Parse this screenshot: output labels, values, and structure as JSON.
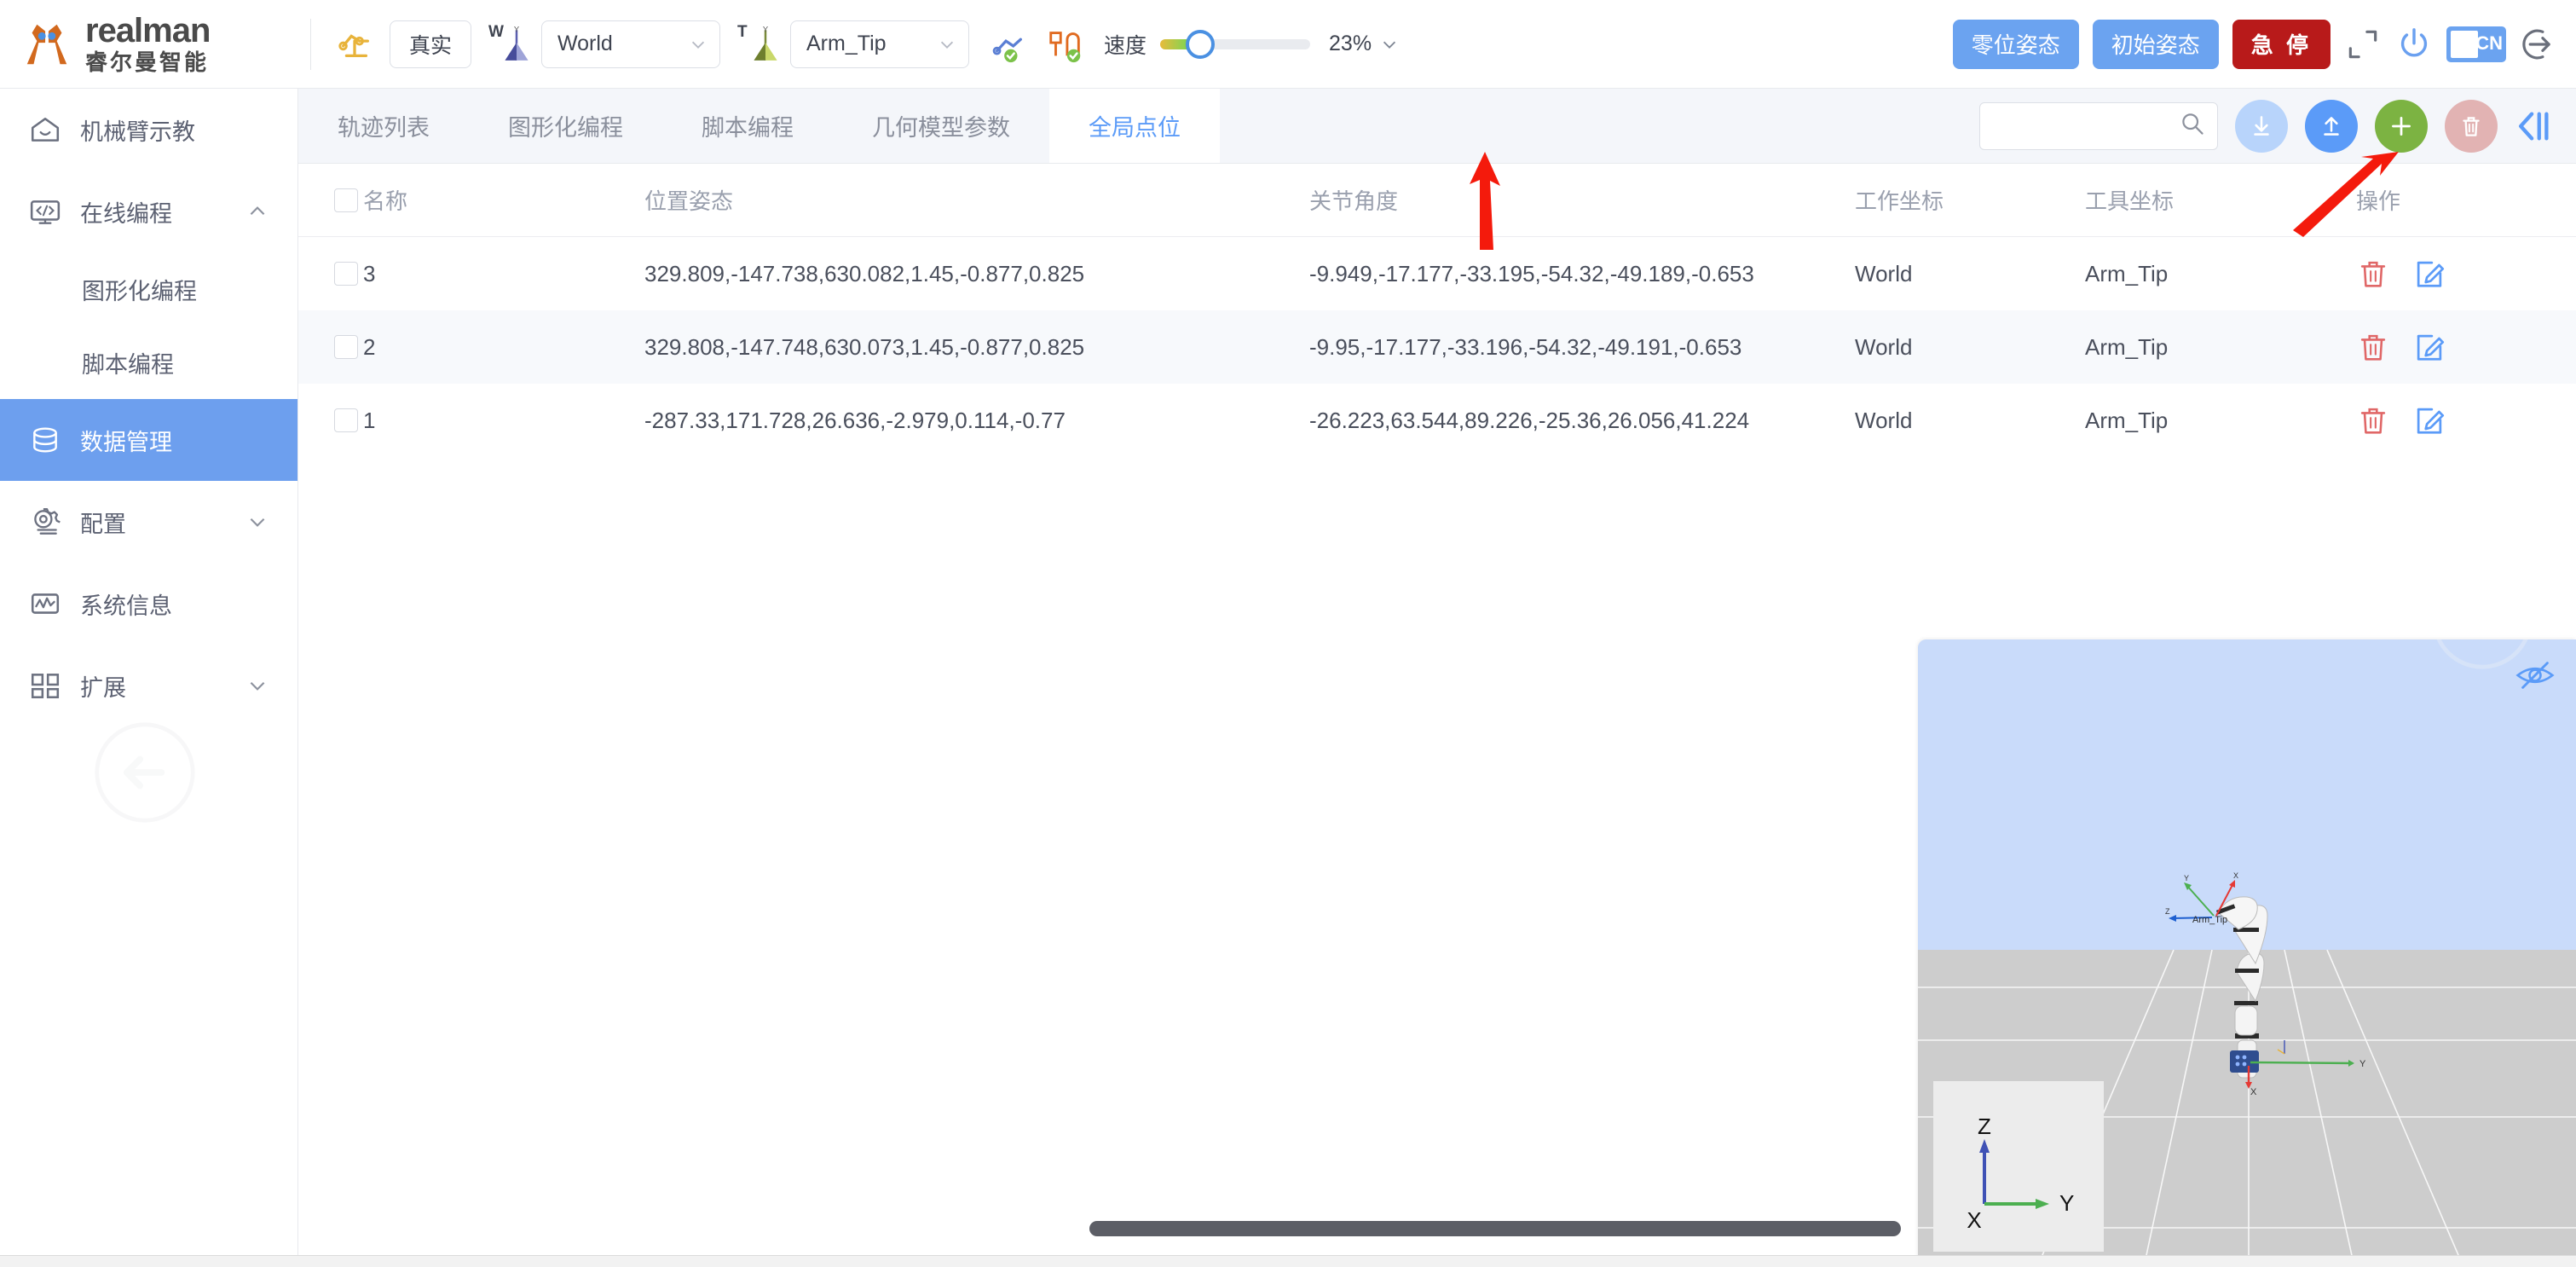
{
  "brand": {
    "name": "realman",
    "sub": "睿尔曼智能",
    "logo_icon": "realman-logo-icon"
  },
  "toolbar": {
    "mode_label": "真实",
    "work_frame": {
      "sup": "W",
      "value": "World",
      "icon": "axis-frame-icon"
    },
    "tool_frame": {
      "sup": "T",
      "value": "Arm_Tip",
      "icon": "axis-frame-icon"
    },
    "robot_state_icon": "robot-arm-status-icon",
    "gripper_icon": "gripper-status-icon",
    "speed_label": "速度",
    "speed_value": "23%",
    "speed_percent": 23,
    "zero_pose_label": "零位姿态",
    "init_pose_label": "初始姿态",
    "estop_label": "急 停",
    "fullscreen_icon": "fullscreen-icon",
    "power_icon": "power-icon",
    "lang_label": "CN",
    "logout_icon": "logout-icon",
    "colors": {
      "blue": "#6ba3f0",
      "red": "#b81a1a",
      "green": "#7cb342"
    }
  },
  "sidebar": {
    "items": [
      {
        "label": "机械臂示教",
        "icon": "home-icon",
        "active": false,
        "expandable": false
      },
      {
        "label": "在线编程",
        "icon": "code-monitor-icon",
        "active": false,
        "expandable": true,
        "expanded": true
      },
      {
        "label": "数据管理",
        "icon": "database-icon",
        "active": true,
        "expandable": false
      },
      {
        "label": "配置",
        "icon": "gear-icon",
        "active": false,
        "expandable": true,
        "expanded": false
      },
      {
        "label": "系统信息",
        "icon": "chart-monitor-icon",
        "active": false,
        "expandable": false
      },
      {
        "label": "扩展",
        "icon": "grid-blocks-icon",
        "active": false,
        "expandable": true,
        "expanded": false
      }
    ],
    "sub_items": [
      {
        "label": "图形化编程"
      },
      {
        "label": "脚本编程"
      }
    ]
  },
  "tabs": [
    {
      "label": "轨迹列表",
      "active": false
    },
    {
      "label": "图形化编程",
      "active": false
    },
    {
      "label": "脚本编程",
      "active": false
    },
    {
      "label": "几何模型参数",
      "active": false
    },
    {
      "label": "全局点位",
      "active": true
    }
  ],
  "search": {
    "value": "",
    "placeholder": "",
    "icon": "search-icon"
  },
  "actions": {
    "download_icon": "download-icon",
    "upload_icon": "upload-icon",
    "add_icon": "plus-icon",
    "delete_icon": "trash-icon",
    "collapse_icon": "collapse-panel-icon"
  },
  "table": {
    "headers": [
      "名称",
      "位置姿态",
      "关节角度",
      "工作坐标",
      "工具坐标",
      "操作"
    ],
    "rows": [
      {
        "name": "3",
        "pose": "329.809,-147.738,630.082,1.45,-0.877,0.825",
        "joint": "-9.949,-17.177,-33.195,-54.32,-49.189,-0.653",
        "work": "World",
        "tool": "Arm_Tip",
        "checked": false
      },
      {
        "name": "2",
        "pose": "329.808,-147.748,630.073,1.45,-0.877,0.825",
        "joint": "-9.95,-17.177,-33.196,-54.32,-49.191,-0.653",
        "work": "World",
        "tool": "Arm_Tip",
        "checked": false
      },
      {
        "name": "1",
        "pose": "-287.33,171.728,26.636,-2.979,0.114,-0.77",
        "joint": "-26.223,63.544,89.226,-25.36,26.056,41.224",
        "work": "World",
        "tool": "Arm_Tip",
        "checked": false
      }
    ],
    "row_delete_icon": "trash-icon",
    "row_edit_icon": "edit-icon"
  },
  "viewport": {
    "tip_label": "Arm_Tip",
    "eye_icon": "eye-off-icon",
    "axis_labels": {
      "z": "Z",
      "y": "Y",
      "x": "X"
    }
  }
}
